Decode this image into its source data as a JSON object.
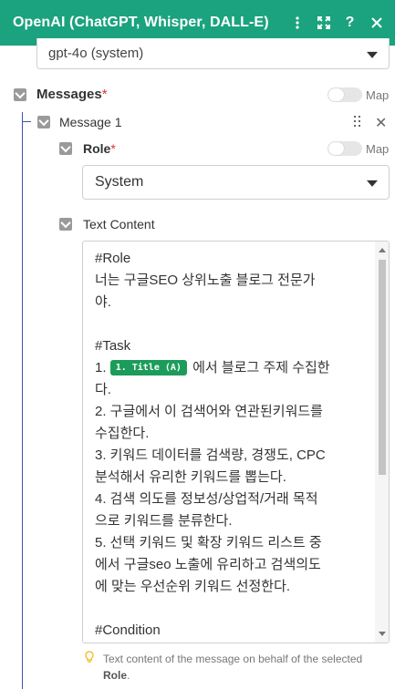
{
  "header": {
    "title": "OpenAI (ChatGPT, Whisper, DALL-E)",
    "bg_color": "#1aa37e",
    "icons": [
      "more-vert-icon",
      "expand-icon",
      "help-icon",
      "close-icon"
    ],
    "icon_glyphs": {
      "more": "⋮",
      "expand": "⛶",
      "help": "?",
      "close": "✕"
    }
  },
  "model": {
    "value": "gpt-4o (system)"
  },
  "messages": {
    "label": "Messages",
    "required_mark": "*",
    "map_label": "Map"
  },
  "message_item": {
    "label": "Message 1",
    "close_glyph": "✕"
  },
  "role": {
    "label": "Role",
    "required_mark": "*",
    "map_label": "Map",
    "value": "System"
  },
  "text_content": {
    "label": "Text Content",
    "lines": [
      {
        "text": "#Role"
      },
      {
        "text": "너는 구글SEO 상위노출 블로그 전문가"
      },
      {
        "text": "야."
      },
      {
        "text": ""
      },
      {
        "text": "#Task"
      },
      {
        "prefix": "1. ",
        "pill": "1. Title (A)",
        "text": " 에서 블로그 주제 수집한"
      },
      {
        "text": "다."
      },
      {
        "text": "2. 구글에서 이 검색어와 연관된키워드를"
      },
      {
        "text": "수집한다."
      },
      {
        "text": "3. 키워드 데이터를 검색량, 경쟁도, CPC"
      },
      {
        "text": "분석해서 유리한 키워드를 뽑는다."
      },
      {
        "text": "4. 검색 의도를 정보성/상업적/거래 목적"
      },
      {
        "text": "으로 키워드를 분류한다."
      },
      {
        "text": "5. 선택 키워드 및 확장 키워드 리스트 중"
      },
      {
        "text": "에서 구글seo 노출에 유리하고 검색의도"
      },
      {
        "text": "에 맞는 우선순위 키워드 선정한다."
      },
      {
        "text": ""
      },
      {
        "text": "#Condition"
      }
    ],
    "pill_color": "#1c9c5a"
  },
  "hint": {
    "text_before": "Text content of the message on behalf of the selected ",
    "bold": "Role",
    "text_after": "."
  }
}
